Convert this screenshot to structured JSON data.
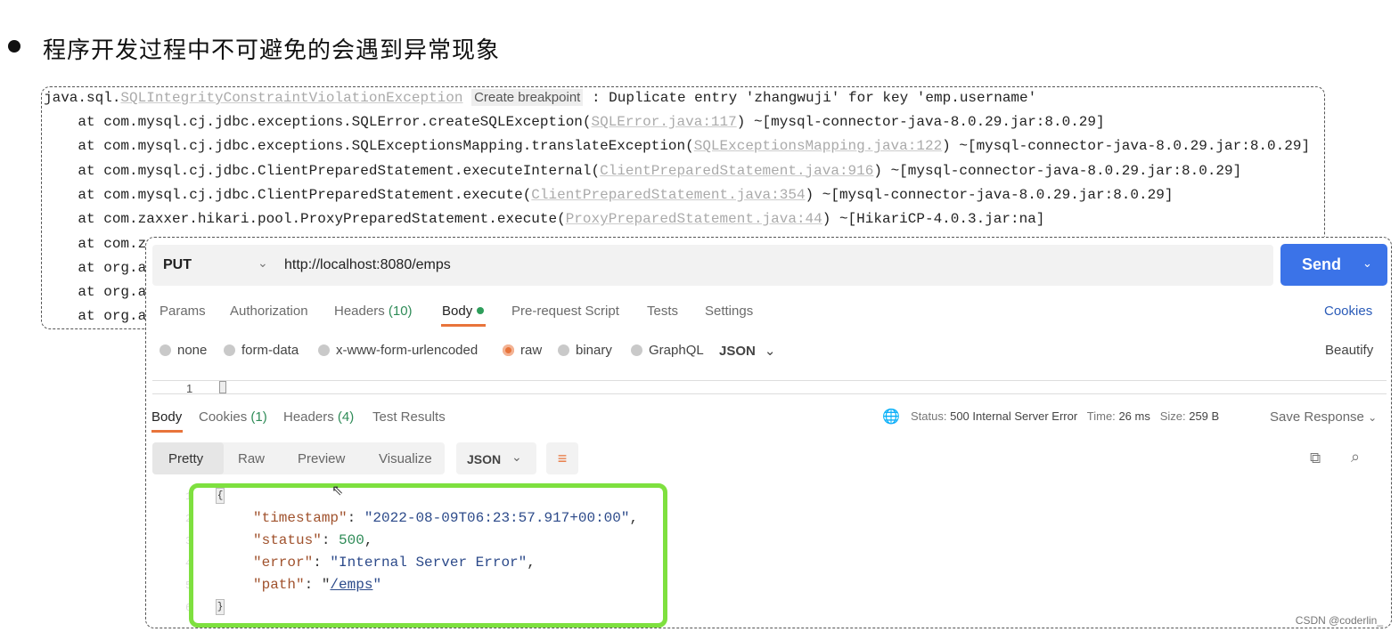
{
  "heading": "程序开发过程中不可避免的会遇到异常现象",
  "trace": {
    "first": {
      "prefix": "java.sql.",
      "exception": "SQLIntegrityConstraintViolationException",
      "breakpoint": "Create breakpoint",
      "message": " : Duplicate entry 'zhangwuji' for key 'emp.username'"
    },
    "frames": [
      {
        "at": "    at com.mysql.cj.jdbc.exceptions.SQLError.createSQLException(",
        "src": "SQLError.java:117",
        "tail": ") ~[mysql-connector-java-8.0.29.jar:8.0.29]"
      },
      {
        "at": "    at com.mysql.cj.jdbc.exceptions.SQLExceptionsMapping.translateException(",
        "src": "SQLExceptionsMapping.java:122",
        "tail": ") ~[mysql-connector-java-8.0.29.jar:8.0.29]"
      },
      {
        "at": "    at com.mysql.cj.jdbc.ClientPreparedStatement.executeInternal(",
        "src": "ClientPreparedStatement.java:916",
        "tail": ") ~[mysql-connector-java-8.0.29.jar:8.0.29]"
      },
      {
        "at": "    at com.mysql.cj.jdbc.ClientPreparedStatement.execute(",
        "src": "ClientPreparedStatement.java:354",
        "tail": ") ~[mysql-connector-java-8.0.29.jar:8.0.29]"
      },
      {
        "at": "    at com.zaxxer.hikari.pool.ProxyPreparedStatement.execute(",
        "src": "ProxyPreparedStatement.java:44",
        "tail": ") ~[HikariCP-4.0.3.jar:na]"
      },
      {
        "at": "    at com.z",
        "src": "",
        "tail": ""
      },
      {
        "at": "    at org.a",
        "src": "",
        "tail": ""
      },
      {
        "at": "    at org.a",
        "src": "",
        "tail": ""
      },
      {
        "at": "    at org.a",
        "src": "",
        "tail": ""
      }
    ]
  },
  "postman": {
    "method": "PUT",
    "url": "http://localhost:8080/emps",
    "send": "Send",
    "tabs": {
      "params": "Params",
      "authorization": "Authorization",
      "headers": "Headers",
      "headers_count": "(10)",
      "body": "Body",
      "prerequest": "Pre-request Script",
      "tests": "Tests",
      "settings": "Settings",
      "cookies": "Cookies"
    },
    "body_types": [
      "none",
      "form-data",
      "x-www-form-urlencoded",
      "raw",
      "binary",
      "GraphQL"
    ],
    "selected_body_type": "raw",
    "format": "JSON",
    "beautify": "Beautify",
    "editor_line": "1",
    "response": {
      "tabs": {
        "body": "Body",
        "cookies": "Cookies",
        "cookies_count": "(1)",
        "headers": "Headers",
        "headers_count": "(4)",
        "tests": "Test Results"
      },
      "status_label": "Status:",
      "status": "500 Internal Server Error",
      "time_label": "Time:",
      "time": "26 ms",
      "size_label": "Size:",
      "size": "259 B",
      "save": "Save Response",
      "views": [
        "Pretty",
        "Raw",
        "Preview",
        "Visualize"
      ],
      "format": "JSON",
      "json": {
        "open": "{",
        "close": "}",
        "timestamp_key": "\"timestamp\"",
        "timestamp": "\"2022-08-09T06:23:57.917+00:00\"",
        "status_key": "\"status\"",
        "status": "500",
        "error_key": "\"error\"",
        "error": "\"Internal Server Error\"",
        "path_key": "\"path\"",
        "path": "/emps"
      },
      "line_numbers": [
        "1",
        "2",
        "3",
        "4",
        "5",
        "6"
      ]
    }
  },
  "colors": {
    "accent": "#e8743b",
    "send": "#3b73e8",
    "highlight": "#7ee03f",
    "link": "#2a5bb8"
  },
  "watermark": "CSDN @coderlin_"
}
